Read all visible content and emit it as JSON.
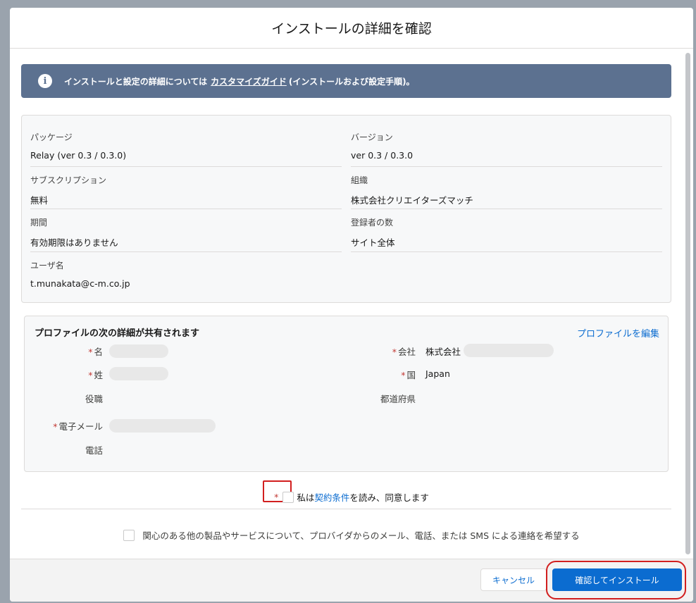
{
  "modal": {
    "title": "インストールの詳細を確認"
  },
  "banner": {
    "icon": "info-icon",
    "text_before": "インストールと設定の詳細については",
    "link": "カスタマイズガイド",
    "text_after": "(インストールおよび設定手順)。"
  },
  "details": {
    "package_label": "パッケージ",
    "package_value": "Relay (ver 0.3 / 0.3.0)",
    "version_label": "バージョン",
    "version_value": "ver 0.3 / 0.3.0",
    "subscription_label": "サブスクリプション",
    "subscription_value": "無料",
    "org_label": "組織",
    "org_value": "株式会社クリエイターズマッチ",
    "period_label": "期間",
    "period_value": "有効期限はありません",
    "subscribers_label": "登録者の数",
    "subscribers_value": "サイト全体",
    "username_label": "ユーザ名",
    "username_value": "t.munakata@c-m.co.jp"
  },
  "profile": {
    "title": "プロファイルの次の詳細が共有されます",
    "edit_link": "プロファイルを編集",
    "first_name_label": "名",
    "last_name_label": "姓",
    "job_title_label": "役職",
    "email_label": "電子メール",
    "phone_label": "電話",
    "company_label": "会社",
    "company_value": "株式会社",
    "country_label": "国",
    "country_value": "Japan",
    "state_label": "都道府県",
    "required_marker": "*"
  },
  "agreement": {
    "required_marker": "*",
    "text_before": "私は",
    "link": "契約条件",
    "text_after": "を読み、同意します"
  },
  "optin": {
    "text": "関心のある他の製品やサービスについて、プロバイダからのメール、電話、または SMS による連絡を希望する"
  },
  "footer": {
    "cancel_label": "キャンセル",
    "confirm_label": "確認してインストール"
  },
  "colors": {
    "brand": "#0b6cd0",
    "banner": "#5c7190",
    "highlight": "#d21f1f"
  }
}
